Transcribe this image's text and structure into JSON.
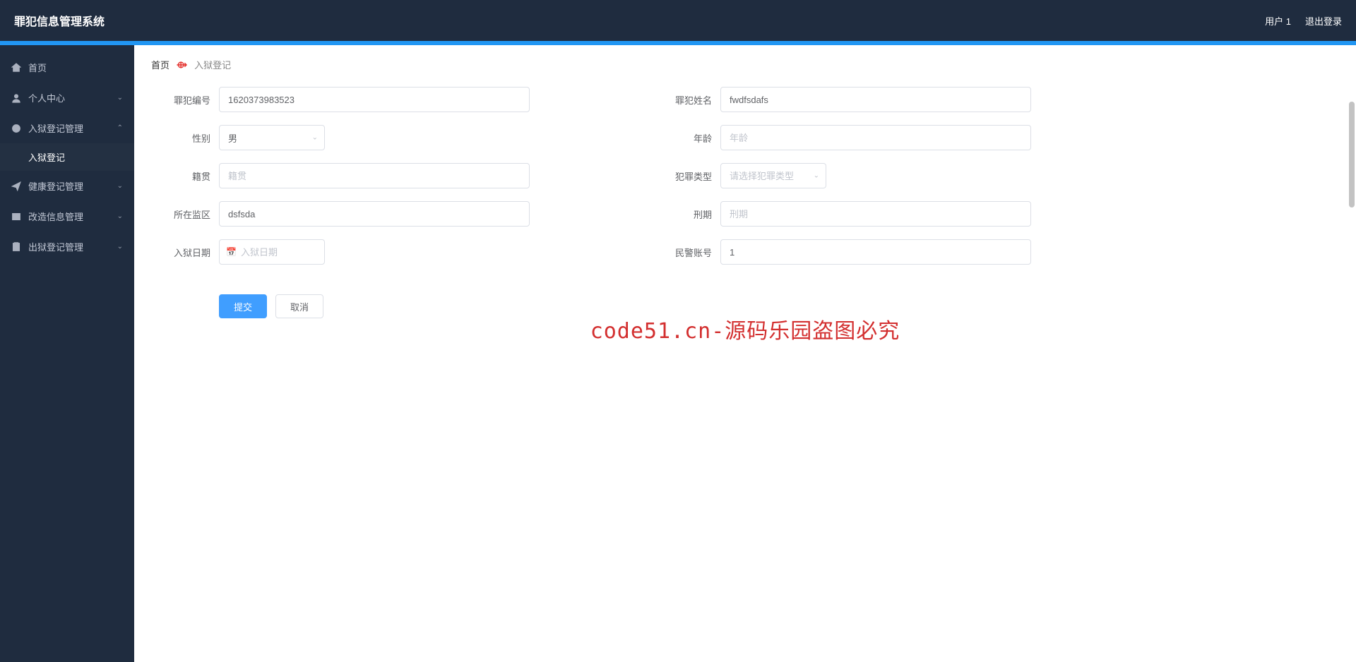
{
  "header": {
    "title": "罪犯信息管理系统",
    "user": "用户 1",
    "logout": "退出登录"
  },
  "sidebar": {
    "items": [
      {
        "label": "首页",
        "icon": "home",
        "expandable": false
      },
      {
        "label": "个人中心",
        "icon": "user",
        "expandable": true
      },
      {
        "label": "入狱登记管理",
        "icon": "power",
        "expandable": true,
        "expanded": true,
        "children": [
          {
            "label": "入狱登记"
          }
        ]
      },
      {
        "label": "健康登记管理",
        "icon": "send",
        "expandable": true
      },
      {
        "label": "改造信息管理",
        "icon": "window",
        "expandable": true
      },
      {
        "label": "出狱登记管理",
        "icon": "clipboard",
        "expandable": true
      }
    ]
  },
  "breadcrumb": {
    "home": "首页",
    "current": "入狱登记"
  },
  "form": {
    "id_label": "罪犯编号",
    "id_value": "1620373983523",
    "name_label": "罪犯姓名",
    "name_value": "fwdfsdafs",
    "gender_label": "性别",
    "gender_value": "男",
    "age_label": "年龄",
    "age_placeholder": "年龄",
    "origin_label": "籍贯",
    "origin_placeholder": "籍贯",
    "crime_type_label": "犯罪类型",
    "crime_type_placeholder": "请选择犯罪类型",
    "prison_label": "所在监区",
    "prison_value": "dsfsda",
    "sentence_label": "刑期",
    "sentence_placeholder": "刑期",
    "indate_label": "入狱日期",
    "indate_placeholder": "入狱日期",
    "police_label": "民警账号",
    "police_value": "1"
  },
  "buttons": {
    "submit": "提交",
    "cancel": "取消"
  },
  "watermark": "code51.cn-源码乐园盗图必究"
}
